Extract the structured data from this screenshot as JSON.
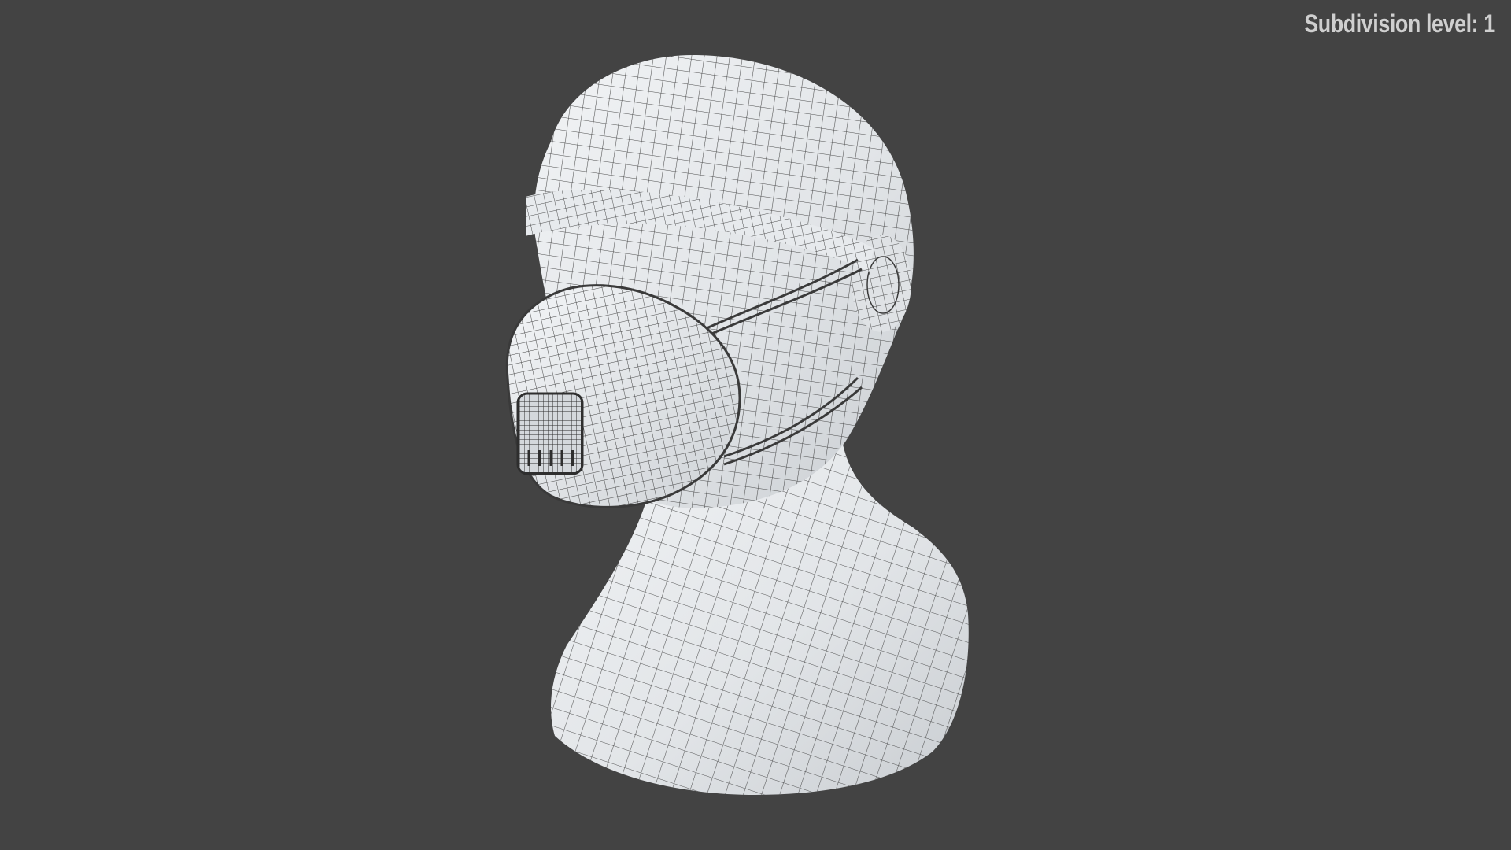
{
  "hud": {
    "subdivision_label": "Subdivision level: 1"
  },
  "viewport": {
    "background_color": "#434343",
    "mesh_fill_color": "#e4e7ea",
    "wire_color": "#3a3a3a",
    "subject": "mesh-wireframe-head-with-respirator"
  }
}
